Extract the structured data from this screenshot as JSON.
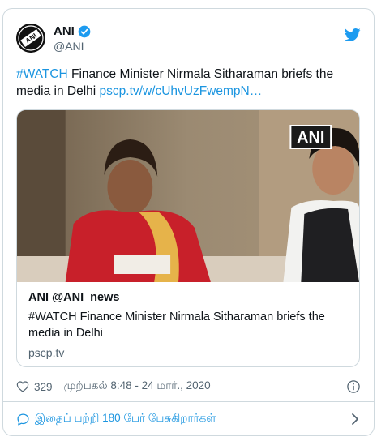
{
  "author": {
    "display_name": "ANI",
    "handle": "@ANI",
    "avatar_logo_text": "ANI"
  },
  "tweet": {
    "hashtag": "#WATCH",
    "text": " Finance Minister Nirmala Sitharaman briefs the media in Delhi ",
    "link_text": "pscp.tv/w/cUhvUzFwempN…"
  },
  "card": {
    "media_watermark": "ANI",
    "title": "ANI @ANI_news",
    "description": "#WATCH Finance Minister Nirmala Sitharaman briefs the media in Delhi",
    "domain": "pscp.tv"
  },
  "meta": {
    "like_count": "329",
    "timestamp": "முற்பகல் 8:48 - 24 மார்., 2020"
  },
  "footer": {
    "discussion_text": "இதைப் பற்றி 180 பேர் பேசுகிறார்கள்"
  },
  "colors": {
    "link": "#1b95e0",
    "verified": "#1d9bf0",
    "twitter_brand": "#1d9bf0",
    "muted_text": "#536471",
    "border": "#cfd9de"
  },
  "icons": [
    "ani-logo",
    "verified-badge-icon",
    "twitter-bird-icon",
    "heart-icon",
    "info-icon",
    "speech-bubble-icon",
    "chevron-right-icon"
  ]
}
